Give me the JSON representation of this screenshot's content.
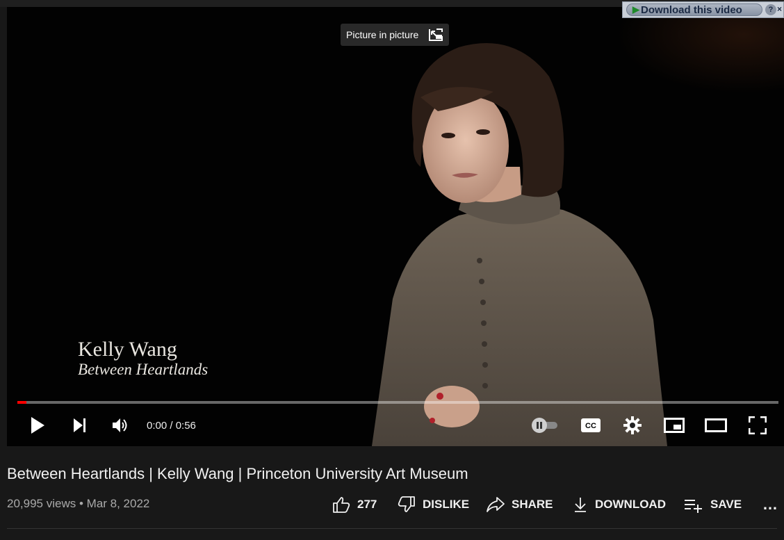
{
  "overlay": {
    "pip_tooltip": "Picture in picture",
    "download_extension": {
      "label": "Download this video",
      "help": "?",
      "close": "×"
    }
  },
  "video": {
    "lower_third": {
      "name": "Kelly Wang",
      "show": "Between Heartlands"
    },
    "progress_fraction": 0.012,
    "progress_color": "#ff0000",
    "time": "0:00 / 0:56",
    "controls": [
      "play-icon",
      "next-icon",
      "volume-icon",
      "autoplay-toggle",
      "subtitles-icon",
      "settings-icon",
      "miniplayer-icon",
      "theater-mode-icon",
      "fullscreen-icon"
    ]
  },
  "info": {
    "title": "Between Heartlands | Kelly Wang | Princeton University Art Museum",
    "views": "20,995 views",
    "separator": "•",
    "date": "Mar 8, 2022"
  },
  "actions": {
    "like_count": "277",
    "dislike": "DISLIKE",
    "share": "SHARE",
    "download": "DOWNLOAD",
    "save": "SAVE",
    "more": "…"
  }
}
